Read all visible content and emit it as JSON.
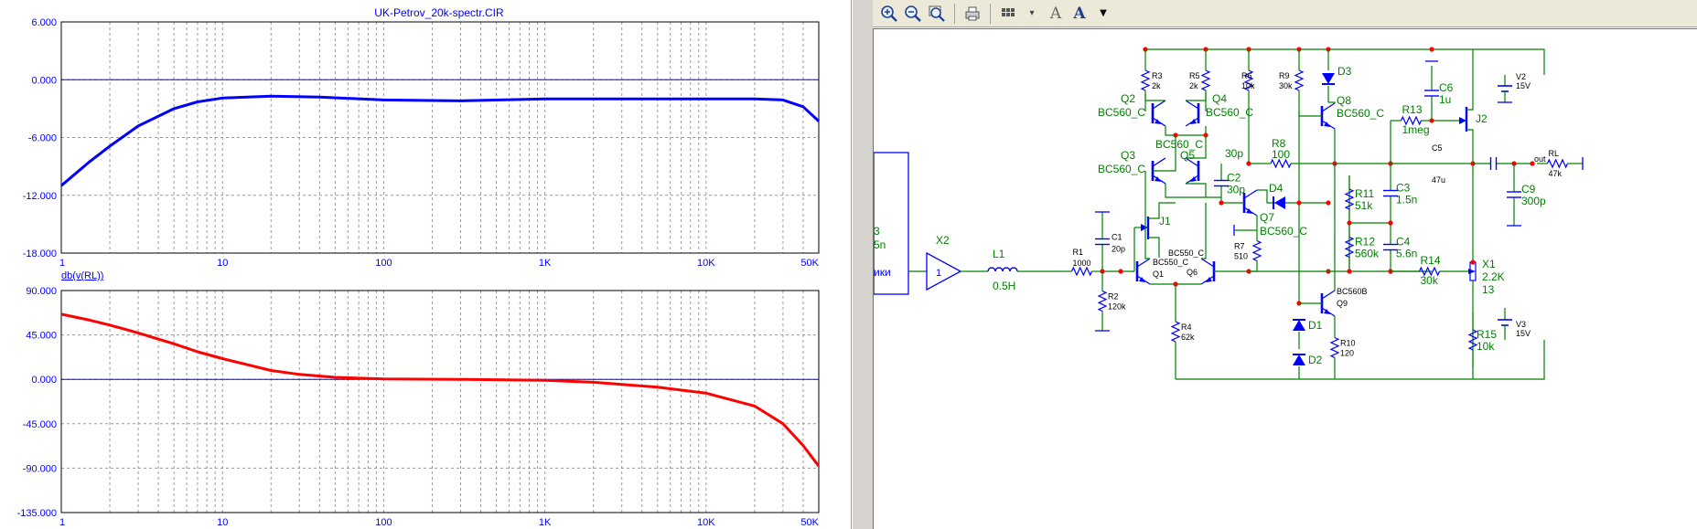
{
  "plot": {
    "title": "UK-Petrov_20k-spectr.CIR",
    "lower_trace_label": "db(v(RL))"
  },
  "chart_data": [
    {
      "type": "line",
      "title": "UK-Petrov_20k-spectr.CIR",
      "xlabel": "",
      "ylabel": "",
      "xscale": "log",
      "xlim": [
        1,
        50000
      ],
      "ylim": [
        -18,
        6
      ],
      "yticks": [
        "6.000",
        "0.000",
        "-6.000",
        "-12.000",
        "-18.000"
      ],
      "xticks": [
        "1",
        "10",
        "100",
        "1K",
        "10K",
        "50K"
      ],
      "grid": true,
      "series": [
        {
          "color": "#0000ff",
          "x": [
            1,
            1.5,
            2,
            3,
            5,
            7,
            10,
            20,
            40,
            100,
            300,
            1000,
            3000,
            10000,
            20000,
            30000,
            40000,
            50000
          ],
          "values": [
            -11.0,
            -8.5,
            -6.9,
            -4.8,
            -3.0,
            -2.3,
            -1.9,
            -1.7,
            -1.8,
            -2.1,
            -2.2,
            -2.0,
            -2.0,
            -2.0,
            -2.0,
            -2.1,
            -2.8,
            -4.3
          ]
        }
      ]
    },
    {
      "type": "line",
      "title": "db(v(RL))",
      "xlabel": "",
      "ylabel": "",
      "xscale": "log",
      "xlim": [
        1,
        50000
      ],
      "ylim": [
        -135,
        90
      ],
      "yticks": [
        "90.000",
        "45.000",
        "0.000",
        "-45.000",
        "-90.000",
        "-135.000"
      ],
      "xticks": [
        "1",
        "10",
        "100",
        "1K",
        "10K",
        "50K"
      ],
      "grid": true,
      "series": [
        {
          "color": "#ff0000",
          "x": [
            1,
            1.5,
            2,
            3,
            5,
            7,
            10,
            15,
            20,
            30,
            50,
            100,
            300,
            1000,
            2000,
            5000,
            10000,
            20000,
            30000,
            40000,
            50000
          ],
          "values": [
            66,
            60,
            55,
            47,
            36,
            28,
            21,
            14,
            9,
            5,
            2,
            0.5,
            0,
            -1,
            -3,
            -8,
            -14,
            -27,
            -45,
            -67,
            -88
          ]
        }
      ]
    }
  ],
  "toolbar": {
    "buttons": [
      "zoom-in",
      "zoom-out",
      "zoom-fit",
      "print",
      "grid",
      "text",
      "font",
      "dropdown"
    ],
    "text_glyph": "A",
    "font_glyph": "A"
  },
  "schematic": {
    "components": {
      "R3": {
        "name": "R3",
        "value": "2k"
      },
      "R5": {
        "name": "R5",
        "value": "2k"
      },
      "R6": {
        "name": "R6",
        "value": "10k"
      },
      "R9": {
        "name": "R9",
        "value": "30k"
      },
      "D3": {
        "name": "D3"
      },
      "Q2": {
        "name": "Q2",
        "model": "BC560_C"
      },
      "Q4": {
        "name": "Q4",
        "model": "BC560_C"
      },
      "Q8": {
        "name": "Q8",
        "model": "BC560_C"
      },
      "Q3": {
        "name": "Q3",
        "model": "BC560_C"
      },
      "Q5": {
        "name": "Q5",
        "model": "BC560_C"
      },
      "C2": {
        "name": "C2",
        "value": "30p"
      },
      "R8": {
        "name": "R8",
        "value": "100"
      },
      "D4": {
        "name": "D4"
      },
      "Q7": {
        "name": "Q7",
        "model": "BC560_C"
      },
      "R7": {
        "name": "R7",
        "value": "510"
      },
      "J1": {
        "name": "J1"
      },
      "Q1": {
        "name": "Q1",
        "model": "BC550_C"
      },
      "Q6": {
        "name": "Q6",
        "model": "BC550_C"
      },
      "Q9": {
        "name": "Q9",
        "model": "BC560B"
      },
      "C1": {
        "name": "C1",
        "value": "20p"
      },
      "R1": {
        "name": "R1",
        "value": "1000"
      },
      "R2": {
        "name": "R2",
        "value": "120k"
      },
      "R4": {
        "name": "R4",
        "value": "62k"
      },
      "L1": {
        "name": "L1",
        "value": "0.5H"
      },
      "X2": {
        "name": "X2",
        "value": "1"
      },
      "D1": {
        "name": "D1"
      },
      "D2": {
        "name": "D2"
      },
      "R10": {
        "name": "R10",
        "value": "120"
      },
      "R11": {
        "name": "R11",
        "value": "51k"
      },
      "R12": {
        "name": "R12",
        "value": "560k"
      },
      "C3": {
        "name": "C3",
        "value": "1.5n"
      },
      "C4": {
        "name": "C4",
        "value": "5.6n"
      },
      "R13": {
        "name": "R13",
        "value": "1meg"
      },
      "C6": {
        "name": "C6",
        "value": "1u"
      },
      "J2": {
        "name": "J2"
      },
      "C5": {
        "name": "C5",
        "value": "47u"
      },
      "RL": {
        "name": "RL",
        "value": "47k"
      },
      "C9": {
        "name": "C9",
        "value": "300p"
      },
      "R14": {
        "name": "R14",
        "value": "30k"
      },
      "X1": {
        "name": "X1",
        "value": "2.2K",
        "extra": "13"
      },
      "R15": {
        "name": "R15",
        "value": "10k"
      },
      "V2": {
        "name": "V2",
        "value": "15V"
      },
      "V3": {
        "name": "V3",
        "value": "15V"
      }
    },
    "out_label": "out",
    "partial_left_top": "3",
    "partial_left_mid": "5n",
    "partial_left_bottom": "ики",
    "colors": {
      "wire": "#008000",
      "component": "#0000ff",
      "node": "#ff0000",
      "label": "#008000"
    }
  }
}
